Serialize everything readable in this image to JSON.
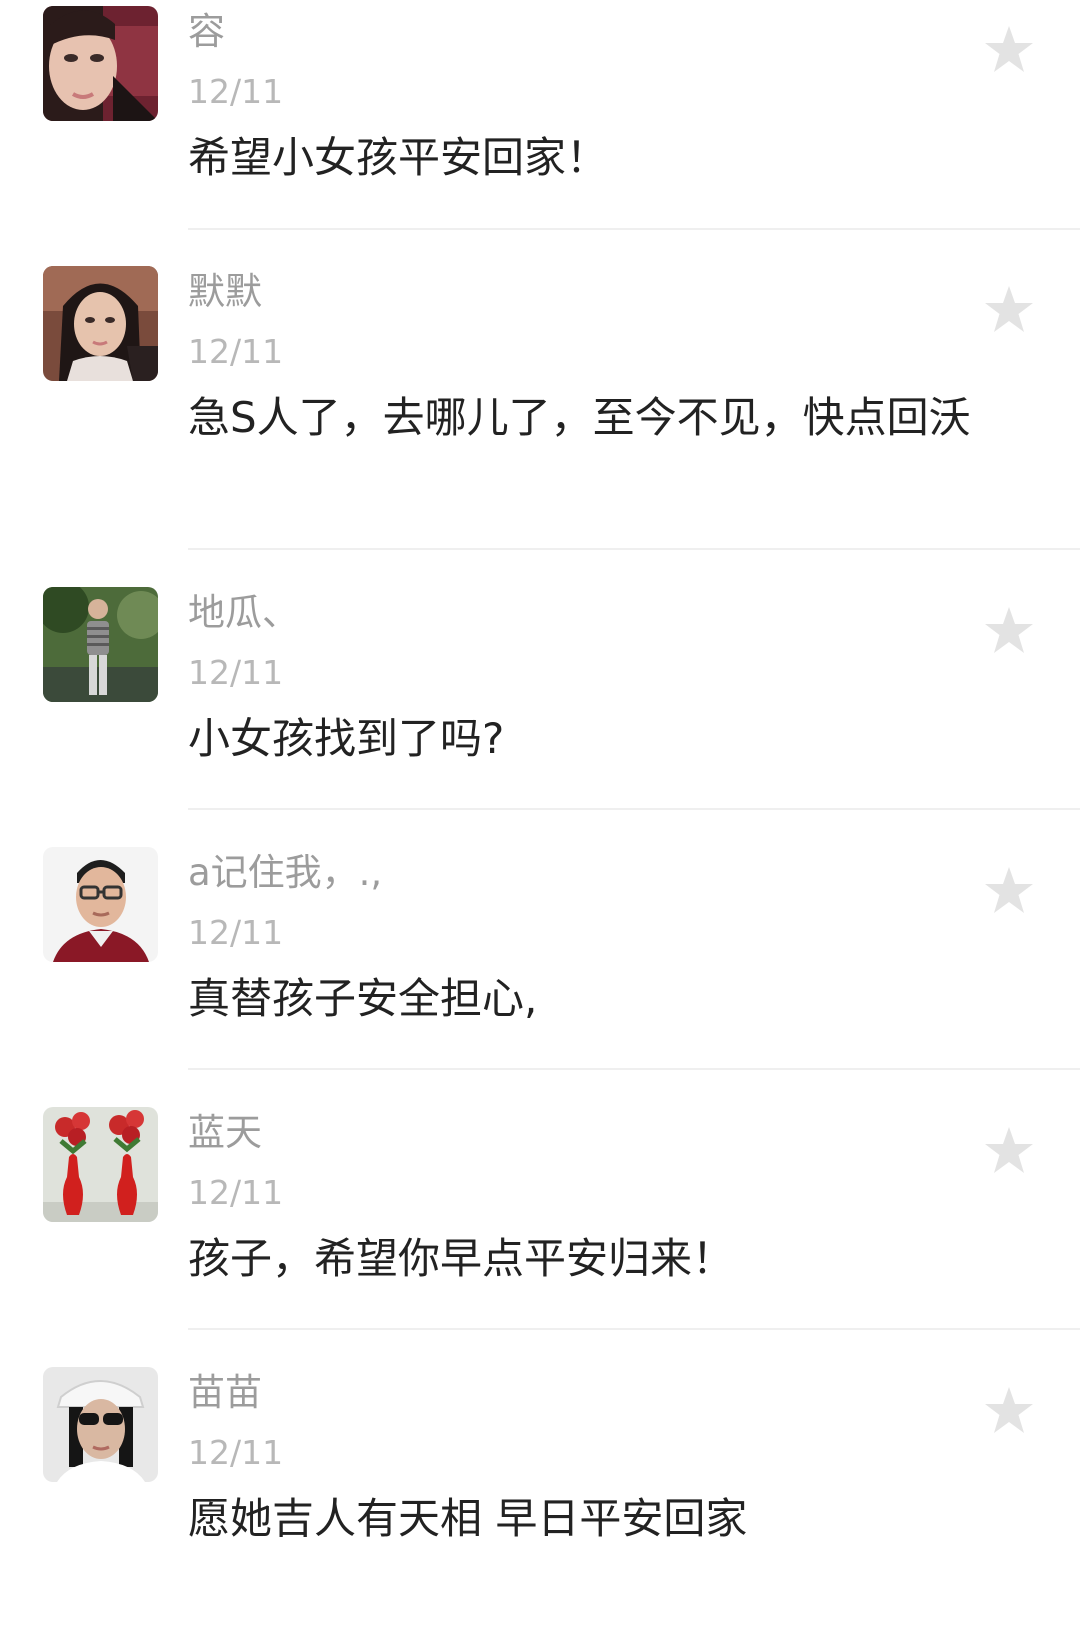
{
  "comments": [
    {
      "nickname": "容",
      "date": "12/11",
      "text": "希望小女孩平安回家！",
      "avatar_icon": "avatar-girl-portrait-icon",
      "avatar_colors": [
        "#e7c2b0",
        "#7c2a36",
        "#2b1b1a"
      ]
    },
    {
      "nickname": "默默",
      "date": "12/11",
      "text": "急S人了，去哪儿了，至今不见，快点回沃",
      "avatar_icon": "avatar-woman-portrait-icon",
      "avatar_colors": [
        "#8a5a4b",
        "#e6c3ad",
        "#1f1615"
      ]
    },
    {
      "nickname": "地瓜、",
      "date": "12/11",
      "text": "小女孩找到了吗?",
      "avatar_icon": "avatar-man-outdoors-icon",
      "avatar_colors": [
        "#3d5a2d",
        "#6f8a55",
        "#cfcfcf"
      ]
    },
    {
      "nickname": "a记住我，.,",
      "date": "12/11",
      "text": "真替孩子安全担心,",
      "avatar_icon": "avatar-man-glasses-icon",
      "avatar_colors": [
        "#f4f4f4",
        "#e2b79c",
        "#8a1826"
      ]
    },
    {
      "nickname": "蓝天",
      "date": "12/11",
      "text": "孩子，希望你早点平安归来！",
      "avatar_icon": "avatar-roses-vases-icon",
      "avatar_colors": [
        "#dfe2db",
        "#c82a2a",
        "#3f7a34"
      ]
    },
    {
      "nickname": "苗苗",
      "date": "12/11",
      "text": "愿她吉人有天相 早日平安回家",
      "avatar_icon": "avatar-woman-sunglasses-icon",
      "avatar_colors": [
        "#e8e8e8",
        "#d9b8a2",
        "#151515"
      ]
    }
  ],
  "star_icon": "star-icon",
  "colors": {
    "nickname": "#9c9c9c",
    "date": "#b8b8b8",
    "text": "#222222",
    "star": "#e3e3e3",
    "divider": "#efefef"
  }
}
